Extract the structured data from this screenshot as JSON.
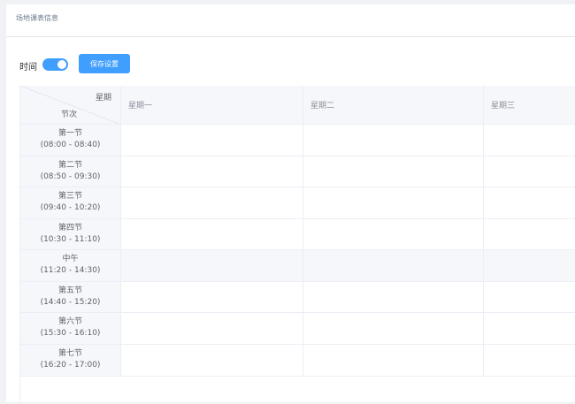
{
  "card": {
    "title": "场地课表信息"
  },
  "toolbar": {
    "time_label": "时间",
    "time_toggle_on": true,
    "save_label": "保存设置"
  },
  "table": {
    "corner_week": "星期",
    "corner_period": "节次",
    "days": [
      "星期一",
      "星期二",
      "星期三"
    ],
    "periods": [
      {
        "name": "第一节",
        "time": "(08:00 - 08:40)"
      },
      {
        "name": "第二节",
        "time": "(08:50 - 09:30)"
      },
      {
        "name": "第三节",
        "time": "(09:40 - 10:20)"
      },
      {
        "name": "第四节",
        "time": "(10:30 - 11:10)"
      },
      {
        "name": "中午",
        "time": "(11:20 - 14:30)"
      },
      {
        "name": "第五节",
        "time": "(14:40 - 15:20)"
      },
      {
        "name": "第六节",
        "time": "(15:30 - 16:10)"
      },
      {
        "name": "第七节",
        "time": "(16:20 - 17:00)"
      }
    ]
  },
  "colors": {
    "accent": "#409eff",
    "header_bg": "#f5f7fa",
    "border": "#ebeef5"
  }
}
